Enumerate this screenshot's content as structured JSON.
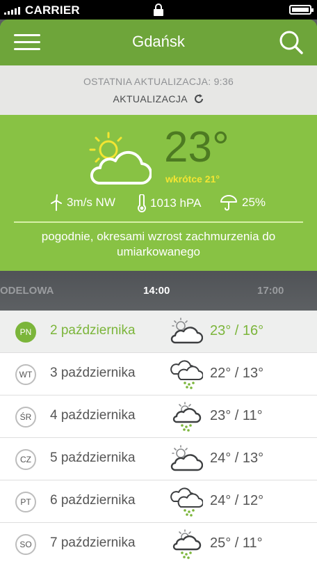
{
  "status_bar": {
    "carrier": "CARRIER"
  },
  "header": {
    "city": "Gdańsk"
  },
  "update": {
    "last_update": "OSTATNIA AKTUALIZACJA: 9:36",
    "button_label": "AKTUALIZACJA"
  },
  "current": {
    "temperature": "23°",
    "soon": "wkrótce 21°",
    "wind": "3m/s NW",
    "pressure": "1013 hPA",
    "precipitation": "25%",
    "description": "pogodnie, okresami wzrost zachmurzenia do umiarkowanego",
    "icon": "partly-cloudy-icon"
  },
  "hours": [
    "ODELOWA",
    "14:00",
    "17:00"
  ],
  "days": [
    {
      "badge": "PN",
      "date": "2 października",
      "range": "23° / 16°",
      "icon": "partly-cloudy-icon"
    },
    {
      "badge": "WT",
      "date": "3 października",
      "range": "22° / 13°",
      "icon": "rain-clouds-icon"
    },
    {
      "badge": "ŚR",
      "date": "4 października",
      "range": "23° / 11°",
      "icon": "sun-rain-icon"
    },
    {
      "badge": "CZ",
      "date": "5 października",
      "range": "24° / 13°",
      "icon": "partly-cloudy-icon"
    },
    {
      "badge": "PT",
      "date": "6 października",
      "range": "24° / 12°",
      "icon": "rain-clouds-icon"
    },
    {
      "badge": "SO",
      "date": "7 października",
      "range": "25° / 11°",
      "icon": "sun-rain-icon"
    }
  ],
  "colors": {
    "header": "#6ea53a",
    "weather_bg": "#88c244",
    "accent_green": "#7bb53a",
    "soon_yellow": "#f3e532",
    "temp_dark": "#4d7a22"
  }
}
